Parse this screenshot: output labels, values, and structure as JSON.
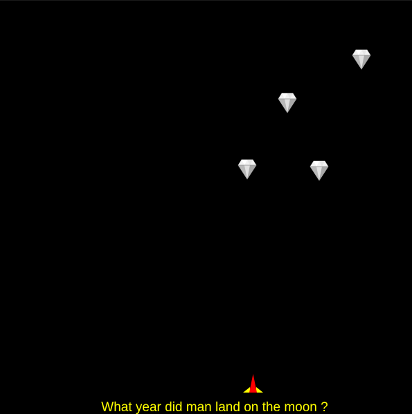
{
  "game": {
    "question": "What year did man land on the moon ?",
    "colors": {
      "background": "#000000",
      "question_text": "#ffff00",
      "ship_body": "#ff0000",
      "ship_wings": "#ffff00",
      "diamond": "#d8d8d8"
    },
    "icons": {
      "target": "diamond-icon",
      "player": "rocket-ship-icon"
    }
  }
}
